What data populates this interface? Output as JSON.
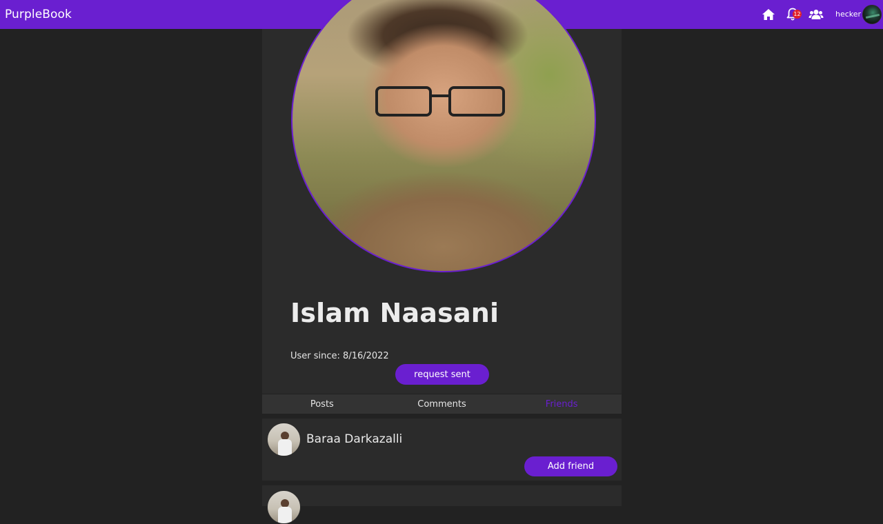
{
  "app": {
    "brand": "PurpleBook",
    "nav": {
      "notification_count": "12",
      "username": "hecker",
      "icons": [
        "home-icon",
        "bell-icon",
        "friends-icon"
      ],
      "page_load_progress": 0.2
    }
  },
  "profile": {
    "name": "Islam Naasani",
    "user_since": "User since: 8/16/2022",
    "request_button": "request sent"
  },
  "tabs": [
    {
      "label": "Posts",
      "active": false
    },
    {
      "label": "Comments",
      "active": false
    },
    {
      "label": "Friends",
      "active": true
    }
  ],
  "friends": [
    {
      "name": "Baraa Darkazalli",
      "action": "Add friend"
    },
    {
      "name": "",
      "action": ""
    }
  ],
  "colors": {
    "accent": "#6a1fd0",
    "background": "#222222",
    "card": "#2b2b2b",
    "tab_bar": "#333333",
    "badge": "#e0202a"
  }
}
